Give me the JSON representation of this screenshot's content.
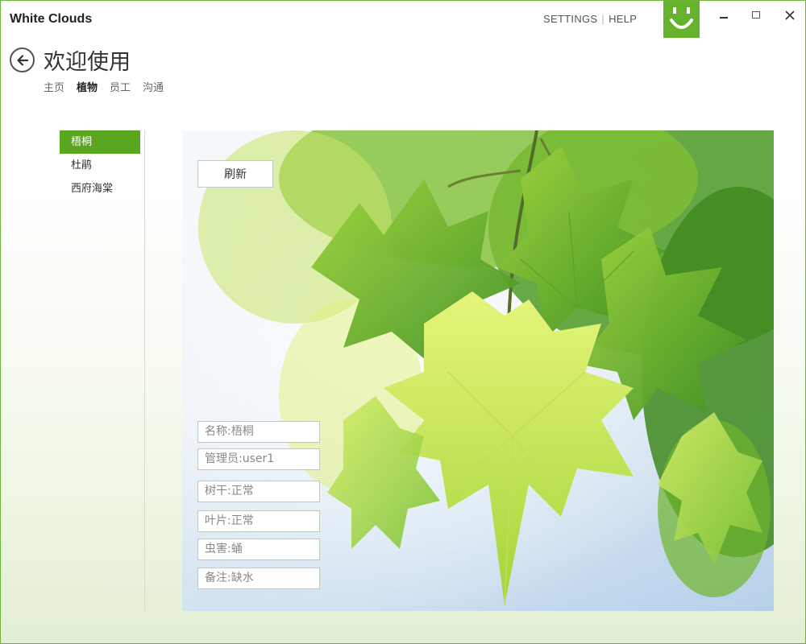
{
  "app": {
    "title": "White Clouds"
  },
  "top_links": {
    "settings": "SETTINGS",
    "separator": "|",
    "help": "HELP"
  },
  "header": {
    "title": "欢迎使用",
    "nav": [
      {
        "label": "主页",
        "active": false
      },
      {
        "label": "植物",
        "active": true
      },
      {
        "label": "员工",
        "active": false
      },
      {
        "label": "沟通",
        "active": false
      }
    ]
  },
  "sidebar": {
    "items": [
      {
        "label": "梧桐",
        "active": true
      },
      {
        "label": "杜鹃",
        "active": false
      },
      {
        "label": "西府海棠",
        "active": false
      }
    ]
  },
  "content": {
    "refresh_label": "刷新",
    "fields": [
      {
        "text": "名称:梧桐"
      },
      {
        "text": "管理员:user1"
      },
      {
        "text": "树干:正常"
      },
      {
        "text": "叶片:正常"
      },
      {
        "text": "虫害:蛹"
      },
      {
        "text": "备注:缺水"
      }
    ]
  },
  "colors": {
    "accent": "#5aa71f",
    "window_border": "#6fb33a",
    "logo_bg": "#67b22c"
  },
  "icons": {
    "back": "back-arrow-icon",
    "logo": "smiley-icon",
    "minimize": "minimize-icon",
    "maximize": "maximize-icon",
    "close": "close-icon"
  }
}
